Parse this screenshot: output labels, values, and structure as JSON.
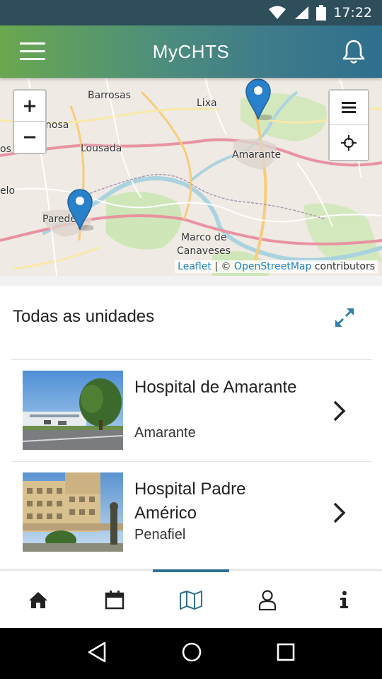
{
  "status_bar": {
    "time": "17:22"
  },
  "header": {
    "title": "MyCHTS"
  },
  "map": {
    "places": {
      "barrosas": "Barrosas",
      "lixa": "Lixa",
      "lousada": "Lousada",
      "amarante": "Amarante",
      "nosa": "nosa",
      "os_freira": "os Freira",
      "elo": "elo",
      "parede": "Parede",
      "marco_1": "Marco de",
      "marco_2": "Canaveses"
    },
    "attribution": {
      "leaflet": "Leaflet",
      "sep": " | © ",
      "osm": "OpenStreetMap",
      "contrib": " contributors"
    },
    "zoom_in": "+",
    "zoom_out": "−"
  },
  "units": {
    "title": "Todas as unidades",
    "items": [
      {
        "name": "Hospital de Amarante",
        "city": "Amarante"
      },
      {
        "name": "Hospital Padre Américo",
        "city": "Penafiel"
      }
    ]
  },
  "bottom_nav": {
    "items": [
      "home-icon",
      "calendar-icon",
      "map-icon",
      "user-icon",
      "info-icon"
    ],
    "active": "map-icon",
    "accent": "#2f6f8f"
  },
  "colors": {
    "header_start": "#6aa84f",
    "header_end": "#2f6f8f",
    "marker": "#2a81cb"
  }
}
